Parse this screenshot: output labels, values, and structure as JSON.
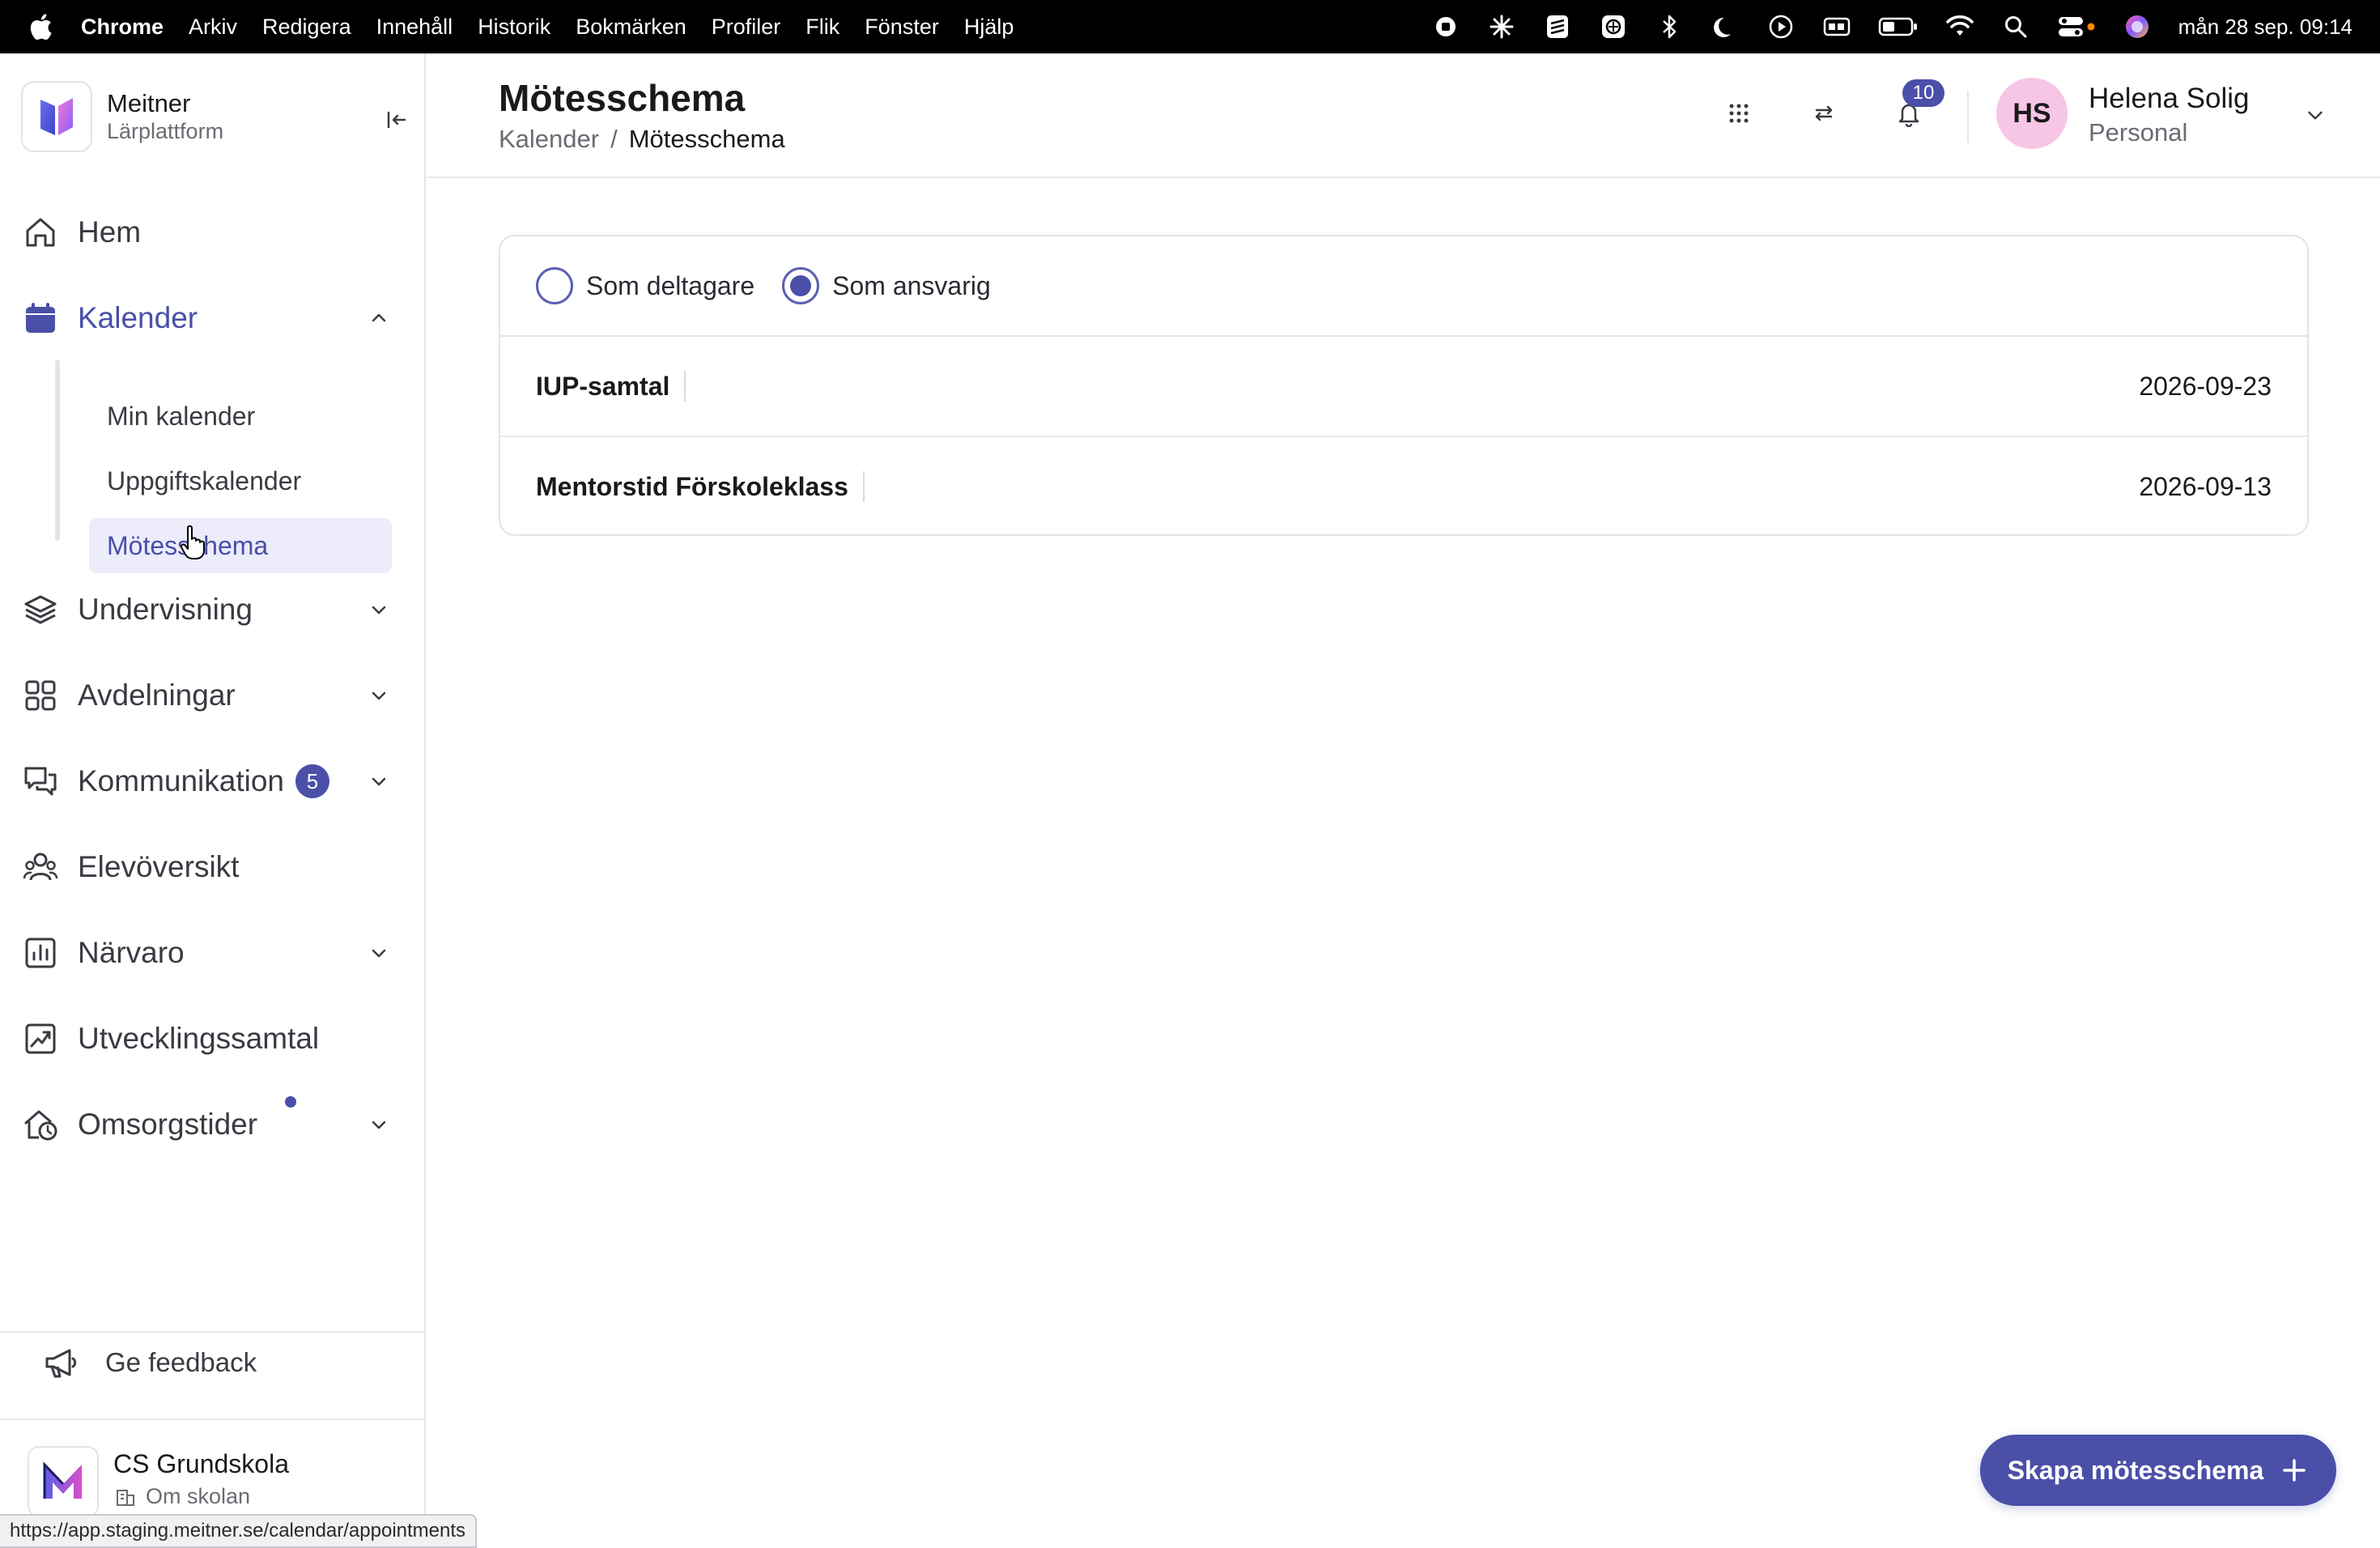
{
  "menubar": {
    "app": "Chrome",
    "items": [
      "Arkiv",
      "Redigera",
      "Innehåll",
      "Historik",
      "Bokmärken",
      "Profiler",
      "Flik",
      "Fönster",
      "Hjälp"
    ],
    "clock": "mån 28 sep. 09:14",
    "status_icons": [
      "record-icon",
      "sparkle-icon",
      "stack-icon",
      "badge-icon",
      "bluetooth-icon",
      "moon-icon",
      "play-icon",
      "battery-box-icon",
      "battery-icon",
      "wifi-icon",
      "spotlight-icon",
      "control-center-icon",
      "siri-icon"
    ]
  },
  "brand": {
    "name": "Meitner",
    "subtitle": "Lärplattform"
  },
  "nav": {
    "home": "Hem",
    "calendar": "Kalender",
    "calendar_sub": [
      "Min kalender",
      "Uppgiftskalender",
      "Mötesschema"
    ],
    "teaching": "Undervisning",
    "departments": "Avdelningar",
    "communication": "Kommunikation",
    "communication_badge": "5",
    "student_overview": "Elevöversikt",
    "attendance": "Närvaro",
    "development_talks": "Utvecklingssamtal",
    "care_times": "Omsorgstider"
  },
  "footer": {
    "feedback": "Ge feedback",
    "school_name": "CS Grundskola",
    "school_link": "Om skolan"
  },
  "status_url": "https://app.staging.meitner.se/calendar/appointments",
  "header": {
    "title": "Mötesschema",
    "breadcrumb_parent": "Kalender",
    "breadcrumb_sep": "/",
    "breadcrumb_current": "Mötesschema",
    "notification_count": "10",
    "avatar_initials": "HS",
    "user_name": "Helena Solig",
    "user_role": "Personal"
  },
  "filters": {
    "participant": "Som deltagare",
    "responsible": "Som ansvarig",
    "selected": "responsible"
  },
  "meetings": [
    {
      "title": "IUP-samtal",
      "date": "2026-09-23"
    },
    {
      "title": "Mentorstid Förskoleklass",
      "date": "2026-09-13"
    }
  ],
  "fab": {
    "label": "Skapa mötesschema"
  },
  "colors": {
    "accent": "#4a4fa8",
    "avatar_bg": "#f7c5e6",
    "active_bg": "#ececfb"
  }
}
